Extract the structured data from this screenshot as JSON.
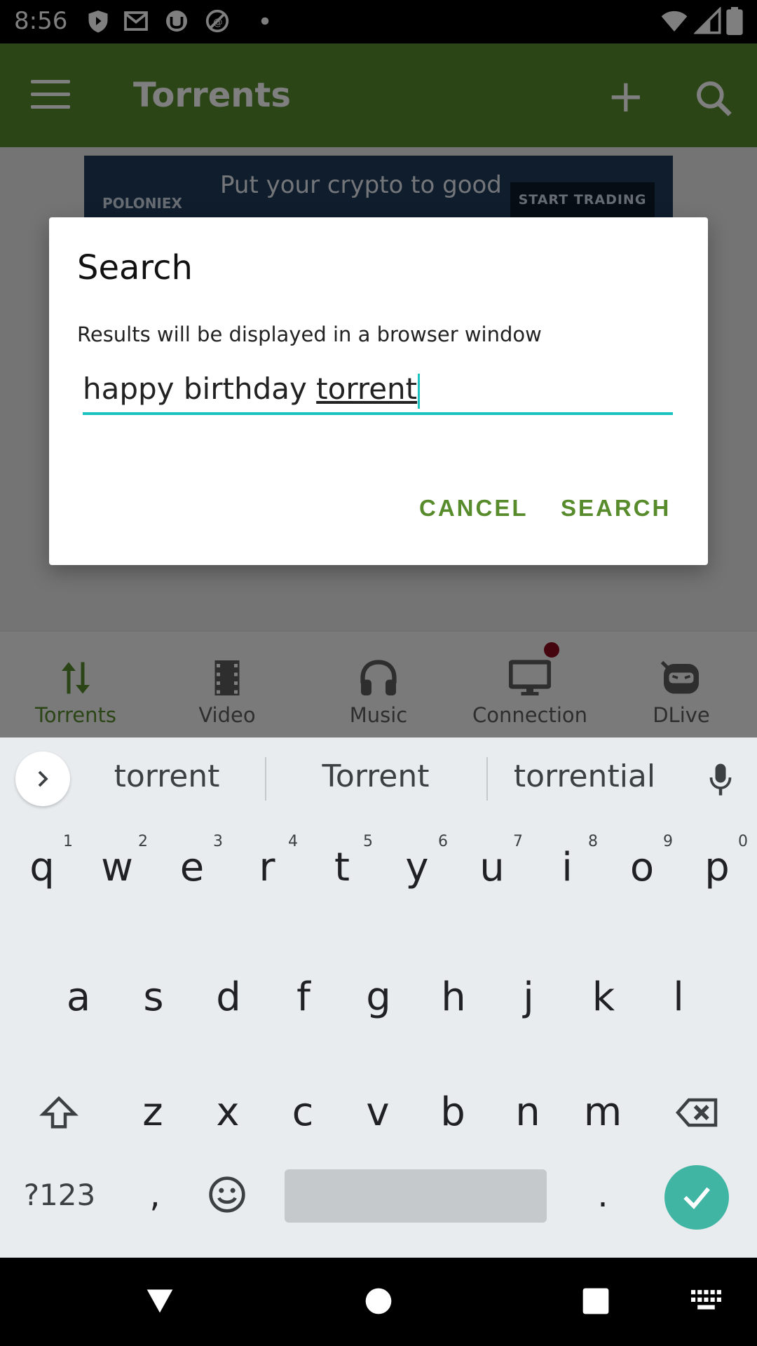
{
  "status_bar": {
    "time": "8:56"
  },
  "app_bar": {
    "title": "Torrents"
  },
  "ad": {
    "brand": "POLONIEX",
    "text": "Put your crypto to good",
    "cta": "START TRADING"
  },
  "dialog": {
    "title": "Search",
    "message": "Results will be displayed in a browser window",
    "input_prefix": "happy birthday ",
    "input_word": "torrent",
    "cancel_label": "CANCEL",
    "search_label": "SEARCH"
  },
  "bottom_nav": {
    "items": [
      {
        "label": "Torrents",
        "icon": "transfer-arrows-icon",
        "active": true
      },
      {
        "label": "Video",
        "icon": "film-icon"
      },
      {
        "label": "Music",
        "icon": "headphones-icon"
      },
      {
        "label": "Connection",
        "icon": "monitor-icon"
      },
      {
        "label": "DLive",
        "icon": "dlive-icon"
      }
    ]
  },
  "keyboard": {
    "suggestions": [
      "torrent",
      "Torrent",
      "torrential"
    ],
    "row1": [
      "q",
      "w",
      "e",
      "r",
      "t",
      "y",
      "u",
      "i",
      "o",
      "p"
    ],
    "row1_nums": [
      "1",
      "2",
      "3",
      "4",
      "5",
      "6",
      "7",
      "8",
      "9",
      "0"
    ],
    "row2": [
      "a",
      "s",
      "d",
      "f",
      "g",
      "h",
      "j",
      "k",
      "l"
    ],
    "row3": [
      "z",
      "x",
      "c",
      "v",
      "b",
      "n",
      "m"
    ],
    "symbols_label": "?123",
    "comma": ",",
    "period": "."
  },
  "colors": {
    "accent": "#578b2c",
    "input_underline": "#1bc3c0",
    "enter": "#41b5a3"
  }
}
